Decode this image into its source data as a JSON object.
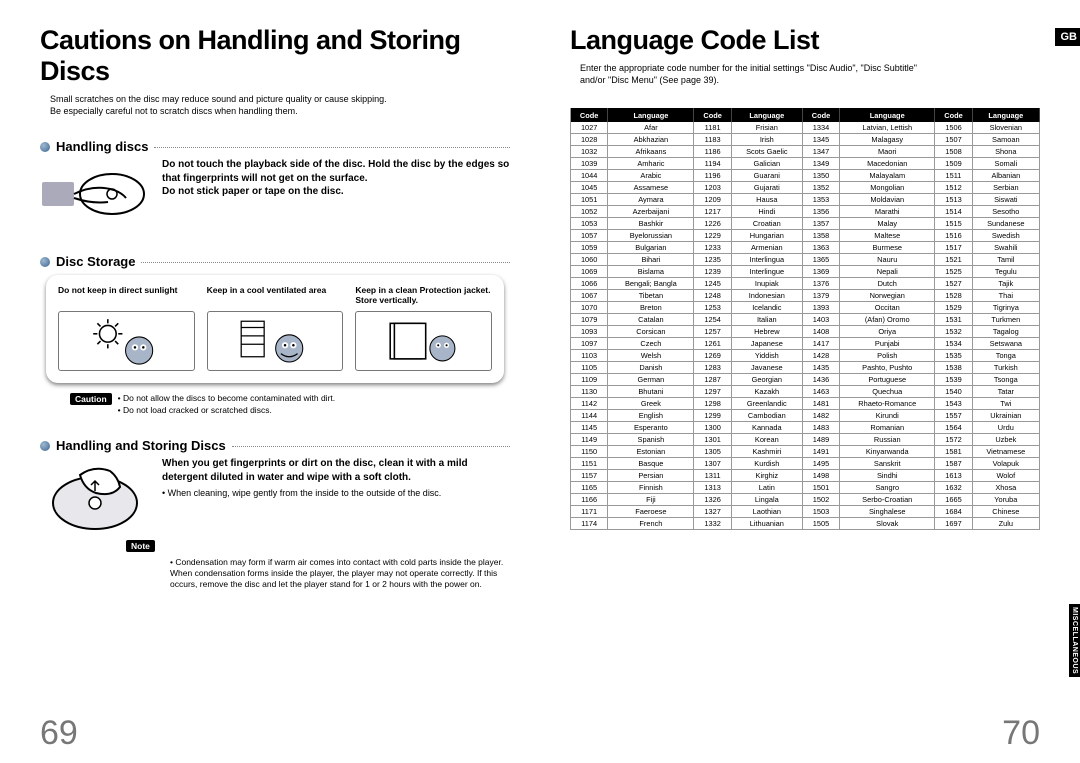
{
  "left": {
    "title": "Cautions on Handling and Storing Discs",
    "intro_l1": "Small scratches on the disc may reduce sound and picture quality or cause skipping.",
    "intro_l2": "Be especially careful not to scratch discs when handling them.",
    "s1": {
      "heading": "Handling discs",
      "text": "Do not touch the playback side of the disc. Hold the disc by the edges so that fingerprints will not get on the surface.\nDo not stick paper or tape on the disc."
    },
    "s2": {
      "heading": "Disc Storage",
      "cols": [
        "Do not keep in direct sunlight",
        "Keep in a cool ventilated area",
        "Keep in a clean Protection jacket. Store vertically."
      ],
      "caution_label": "Caution",
      "caution_items": [
        "Do not allow the discs to become contaminated with dirt.",
        "Do not load cracked or scratched discs."
      ]
    },
    "s3": {
      "heading": "Handling and Storing Discs",
      "bold": "When you get fingerprints or dirt on the disc, clean it with a mild detergent diluted in water and wipe with a soft cloth.",
      "bullet": "When cleaning, wipe gently from the inside to the outside of the disc.",
      "note_label": "Note",
      "note_item": "Condensation may form if warm air comes into contact with cold parts inside the player. When condensation forms inside the player, the player may not operate correctly. If this occurs, remove the disc and let the player stand for 1 or 2 hours with the power on."
    },
    "page_num": "69"
  },
  "right": {
    "title": "Language Code List",
    "gb": "GB",
    "sidetab": "MISCELLANEOUS",
    "intro_l1": "Enter the appropriate code number for the initial settings \"Disc Audio\", \"Disc Subtitle\"",
    "intro_l2": "and/or \"Disc Menu\" (See page 39).",
    "headers": {
      "code": "Code",
      "lang": "Language"
    },
    "chart_data": {
      "type": "table",
      "columns": [
        "Code",
        "Language"
      ],
      "rows_per_column": 37,
      "data": [
        [
          "1027",
          "Afar"
        ],
        [
          "1028",
          "Abkhazian"
        ],
        [
          "1032",
          "Afrikaans"
        ],
        [
          "1039",
          "Amharic"
        ],
        [
          "1044",
          "Arabic"
        ],
        [
          "1045",
          "Assamese"
        ],
        [
          "1051",
          "Aymara"
        ],
        [
          "1052",
          "Azerbaijani"
        ],
        [
          "1053",
          "Bashkir"
        ],
        [
          "1057",
          "Byelorussian"
        ],
        [
          "1059",
          "Bulgarian"
        ],
        [
          "1060",
          "Bihari"
        ],
        [
          "1069",
          "Bislama"
        ],
        [
          "1066",
          "Bengali; Bangla"
        ],
        [
          "1067",
          "Tibetan"
        ],
        [
          "1070",
          "Breton"
        ],
        [
          "1079",
          "Catalan"
        ],
        [
          "1093",
          "Corsican"
        ],
        [
          "1097",
          "Czech"
        ],
        [
          "1103",
          "Welsh"
        ],
        [
          "1105",
          "Danish"
        ],
        [
          "1109",
          "German"
        ],
        [
          "1130",
          "Bhutani"
        ],
        [
          "1142",
          "Greek"
        ],
        [
          "1144",
          "English"
        ],
        [
          "1145",
          "Esperanto"
        ],
        [
          "1149",
          "Spanish"
        ],
        [
          "1150",
          "Estonian"
        ],
        [
          "1151",
          "Basque"
        ],
        [
          "1157",
          "Persian"
        ],
        [
          "1165",
          "Finnish"
        ],
        [
          "1166",
          "Fiji"
        ],
        [
          "1171",
          "Faeroese"
        ],
        [
          "1174",
          "French"
        ],
        [
          "1181",
          "Frisian"
        ],
        [
          "1183",
          "Irish"
        ],
        [
          "1186",
          "Scots Gaelic"
        ],
        [
          "1194",
          "Galician"
        ],
        [
          "1196",
          "Guarani"
        ],
        [
          "1203",
          "Gujarati"
        ],
        [
          "1209",
          "Hausa"
        ],
        [
          "1217",
          "Hindi"
        ],
        [
          "1226",
          "Croatian"
        ],
        [
          "1229",
          "Hungarian"
        ],
        [
          "1233",
          "Armenian"
        ],
        [
          "1235",
          "Interlingua"
        ],
        [
          "1239",
          "Interlingue"
        ],
        [
          "1245",
          "Inupiak"
        ],
        [
          "1248",
          "Indonesian"
        ],
        [
          "1253",
          "Icelandic"
        ],
        [
          "1254",
          "Italian"
        ],
        [
          "1257",
          "Hebrew"
        ],
        [
          "1261",
          "Japanese"
        ],
        [
          "1269",
          "Yiddish"
        ],
        [
          "1283",
          "Javanese"
        ],
        [
          "1287",
          "Georgian"
        ],
        [
          "1297",
          "Kazakh"
        ],
        [
          "1298",
          "Greenlandic"
        ],
        [
          "1299",
          "Cambodian"
        ],
        [
          "1300",
          "Kannada"
        ],
        [
          "1301",
          "Korean"
        ],
        [
          "1305",
          "Kashmiri"
        ],
        [
          "1307",
          "Kurdish"
        ],
        [
          "1311",
          "Kirghiz"
        ],
        [
          "1313",
          "Latin"
        ],
        [
          "1326",
          "Lingala"
        ],
        [
          "1327",
          "Laothian"
        ],
        [
          "1332",
          "Lithuanian"
        ],
        [
          "1334",
          "Latvian, Lettish"
        ],
        [
          "1345",
          "Malagasy"
        ],
        [
          "1347",
          "Maori"
        ],
        [
          "1349",
          "Macedonian"
        ],
        [
          "1350",
          "Malayalam"
        ],
        [
          "1352",
          "Mongolian"
        ],
        [
          "1353",
          "Moldavian"
        ],
        [
          "1356",
          "Marathi"
        ],
        [
          "1357",
          "Malay"
        ],
        [
          "1358",
          "Maltese"
        ],
        [
          "1363",
          "Burmese"
        ],
        [
          "1365",
          "Nauru"
        ],
        [
          "1369",
          "Nepali"
        ],
        [
          "1376",
          "Dutch"
        ],
        [
          "1379",
          "Norwegian"
        ],
        [
          "1393",
          "Occitan"
        ],
        [
          "1403",
          "(Afan) Oromo"
        ],
        [
          "1408",
          "Oriya"
        ],
        [
          "1417",
          "Punjabi"
        ],
        [
          "1428",
          "Polish"
        ],
        [
          "1435",
          "Pashto, Pushto"
        ],
        [
          "1436",
          "Portuguese"
        ],
        [
          "1463",
          "Quechua"
        ],
        [
          "1481",
          "Rhaeto-Romance"
        ],
        [
          "1482",
          "Kirundi"
        ],
        [
          "1483",
          "Romanian"
        ],
        [
          "1489",
          "Russian"
        ],
        [
          "1491",
          "Kinyarwanda"
        ],
        [
          "1495",
          "Sanskrit"
        ],
        [
          "1498",
          "Sindhi"
        ],
        [
          "1501",
          "Sangro"
        ],
        [
          "1502",
          "Serbo-Croatian"
        ],
        [
          "1503",
          "Singhalese"
        ],
        [
          "1505",
          "Slovak"
        ],
        [
          "1506",
          "Slovenian"
        ],
        [
          "1507",
          "Samoan"
        ],
        [
          "1508",
          "Shona"
        ],
        [
          "1509",
          "Somali"
        ],
        [
          "1511",
          "Albanian"
        ],
        [
          "1512",
          "Serbian"
        ],
        [
          "1513",
          "Siswati"
        ],
        [
          "1514",
          "Sesotho"
        ],
        [
          "1515",
          "Sundanese"
        ],
        [
          "1516",
          "Swedish"
        ],
        [
          "1517",
          "Swahili"
        ],
        [
          "1521",
          "Tamil"
        ],
        [
          "1525",
          "Tegulu"
        ],
        [
          "1527",
          "Tajik"
        ],
        [
          "1528",
          "Thai"
        ],
        [
          "1529",
          "Tigrinya"
        ],
        [
          "1531",
          "Turkmen"
        ],
        [
          "1532",
          "Tagalog"
        ],
        [
          "1534",
          "Setswana"
        ],
        [
          "1535",
          "Tonga"
        ],
        [
          "1538",
          "Turkish"
        ],
        [
          "1539",
          "Tsonga"
        ],
        [
          "1540",
          "Tatar"
        ],
        [
          "1543",
          "Twi"
        ],
        [
          "1557",
          "Ukrainian"
        ],
        [
          "1564",
          "Urdu"
        ],
        [
          "1572",
          "Uzbek"
        ],
        [
          "1581",
          "Vietnamese"
        ],
        [
          "1587",
          "Volapuk"
        ],
        [
          "1613",
          "Wolof"
        ],
        [
          "1632",
          "Xhosa"
        ],
        [
          "1665",
          "Yoruba"
        ],
        [
          "1684",
          "Chinese"
        ],
        [
          "1697",
          "Zulu"
        ]
      ]
    },
    "page_num": "70"
  }
}
